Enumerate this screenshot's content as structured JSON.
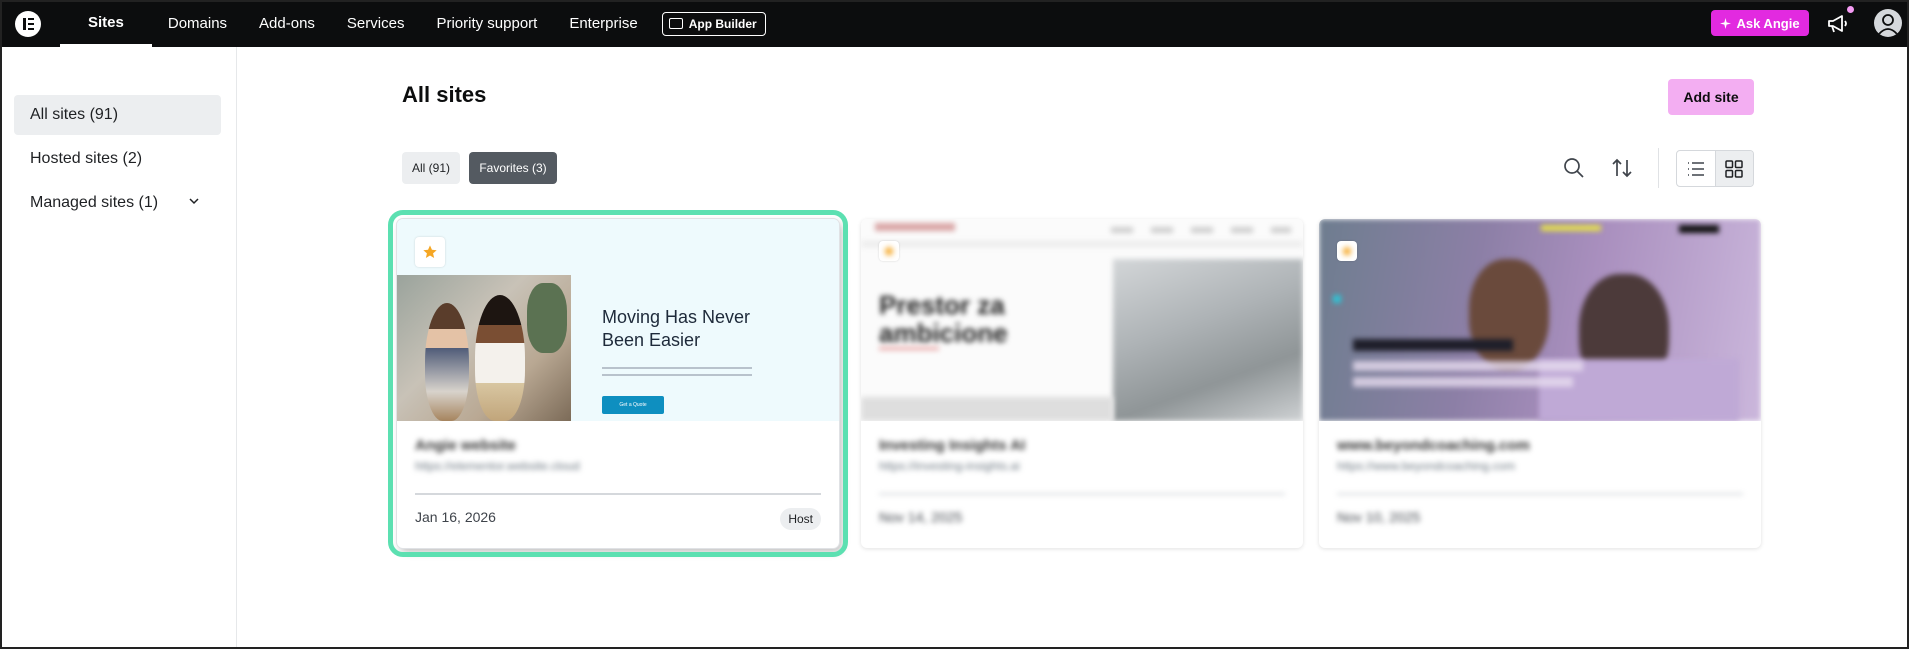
{
  "nav": {
    "items": [
      {
        "label": "Sites",
        "active": true
      },
      {
        "label": "Domains"
      },
      {
        "label": "Add-ons"
      },
      {
        "label": "Services"
      },
      {
        "label": "Priority support"
      },
      {
        "label": "Enterprise"
      }
    ],
    "app_builder_label": "App Builder",
    "ask_angie_label": "Ask Angie"
  },
  "sidebar": {
    "items": [
      {
        "label": "All sites (91)",
        "active": true
      },
      {
        "label": "Hosted sites (2)"
      },
      {
        "label": "Managed sites (1)"
      }
    ]
  },
  "main": {
    "title": "All sites",
    "add_site_label": "Add site",
    "filters": [
      {
        "label": "All (91)"
      },
      {
        "label": "Favorites (3)",
        "active": true
      }
    ]
  },
  "cards": [
    {
      "name": "Angie website",
      "url": "https://elementor.website.cloud",
      "date": "Jan 16, 2026",
      "badge": "Host",
      "thumb_heading": "Moving Has Never Been Easier",
      "thumb_button": "Get a Quote",
      "selected": true
    },
    {
      "name": "Investing Insights AI",
      "url": "https://investing-insights.ai",
      "date": "Nov 14, 2025",
      "thumb_heading": "Prestor za ambicione"
    },
    {
      "name": "www.beyondcoaching.com",
      "url": "https://www.beyondcoaching.com",
      "date": "Nov 10, 2025"
    }
  ],
  "colors": {
    "accent_pink": "#e22ae0",
    "add_site_pink": "#f3aef2",
    "selection_green": "#5ce0b1",
    "favorite_star": "#f5a623"
  }
}
